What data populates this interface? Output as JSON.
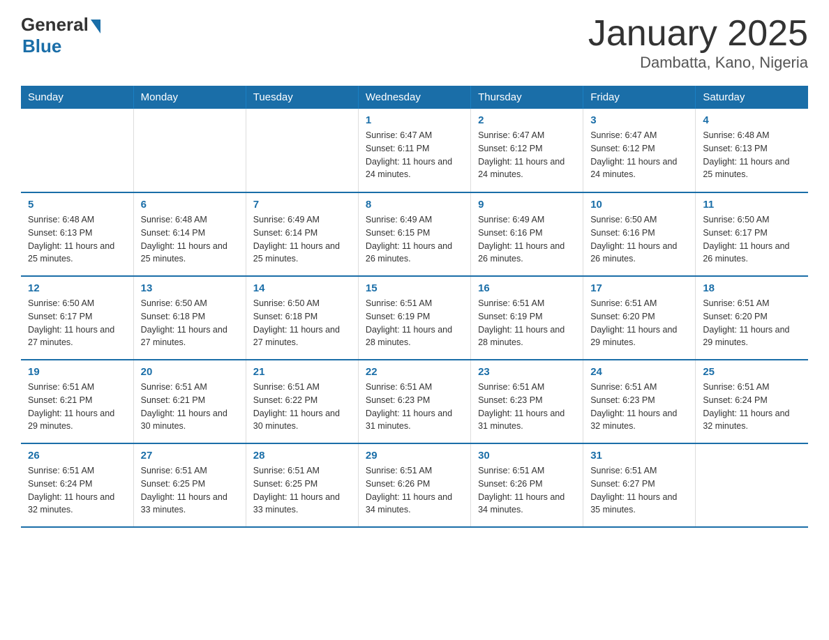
{
  "logo": {
    "general": "General",
    "blue": "Blue"
  },
  "title": "January 2025",
  "subtitle": "Dambatta, Kano, Nigeria",
  "days_of_week": [
    "Sunday",
    "Monday",
    "Tuesday",
    "Wednesday",
    "Thursday",
    "Friday",
    "Saturday"
  ],
  "weeks": [
    [
      {
        "day": "",
        "info": ""
      },
      {
        "day": "",
        "info": ""
      },
      {
        "day": "",
        "info": ""
      },
      {
        "day": "1",
        "info": "Sunrise: 6:47 AM\nSunset: 6:11 PM\nDaylight: 11 hours and 24 minutes."
      },
      {
        "day": "2",
        "info": "Sunrise: 6:47 AM\nSunset: 6:12 PM\nDaylight: 11 hours and 24 minutes."
      },
      {
        "day": "3",
        "info": "Sunrise: 6:47 AM\nSunset: 6:12 PM\nDaylight: 11 hours and 24 minutes."
      },
      {
        "day": "4",
        "info": "Sunrise: 6:48 AM\nSunset: 6:13 PM\nDaylight: 11 hours and 25 minutes."
      }
    ],
    [
      {
        "day": "5",
        "info": "Sunrise: 6:48 AM\nSunset: 6:13 PM\nDaylight: 11 hours and 25 minutes."
      },
      {
        "day": "6",
        "info": "Sunrise: 6:48 AM\nSunset: 6:14 PM\nDaylight: 11 hours and 25 minutes."
      },
      {
        "day": "7",
        "info": "Sunrise: 6:49 AM\nSunset: 6:14 PM\nDaylight: 11 hours and 25 minutes."
      },
      {
        "day": "8",
        "info": "Sunrise: 6:49 AM\nSunset: 6:15 PM\nDaylight: 11 hours and 26 minutes."
      },
      {
        "day": "9",
        "info": "Sunrise: 6:49 AM\nSunset: 6:16 PM\nDaylight: 11 hours and 26 minutes."
      },
      {
        "day": "10",
        "info": "Sunrise: 6:50 AM\nSunset: 6:16 PM\nDaylight: 11 hours and 26 minutes."
      },
      {
        "day": "11",
        "info": "Sunrise: 6:50 AM\nSunset: 6:17 PM\nDaylight: 11 hours and 26 minutes."
      }
    ],
    [
      {
        "day": "12",
        "info": "Sunrise: 6:50 AM\nSunset: 6:17 PM\nDaylight: 11 hours and 27 minutes."
      },
      {
        "day": "13",
        "info": "Sunrise: 6:50 AM\nSunset: 6:18 PM\nDaylight: 11 hours and 27 minutes."
      },
      {
        "day": "14",
        "info": "Sunrise: 6:50 AM\nSunset: 6:18 PM\nDaylight: 11 hours and 27 minutes."
      },
      {
        "day": "15",
        "info": "Sunrise: 6:51 AM\nSunset: 6:19 PM\nDaylight: 11 hours and 28 minutes."
      },
      {
        "day": "16",
        "info": "Sunrise: 6:51 AM\nSunset: 6:19 PM\nDaylight: 11 hours and 28 minutes."
      },
      {
        "day": "17",
        "info": "Sunrise: 6:51 AM\nSunset: 6:20 PM\nDaylight: 11 hours and 29 minutes."
      },
      {
        "day": "18",
        "info": "Sunrise: 6:51 AM\nSunset: 6:20 PM\nDaylight: 11 hours and 29 minutes."
      }
    ],
    [
      {
        "day": "19",
        "info": "Sunrise: 6:51 AM\nSunset: 6:21 PM\nDaylight: 11 hours and 29 minutes."
      },
      {
        "day": "20",
        "info": "Sunrise: 6:51 AM\nSunset: 6:21 PM\nDaylight: 11 hours and 30 minutes."
      },
      {
        "day": "21",
        "info": "Sunrise: 6:51 AM\nSunset: 6:22 PM\nDaylight: 11 hours and 30 minutes."
      },
      {
        "day": "22",
        "info": "Sunrise: 6:51 AM\nSunset: 6:23 PM\nDaylight: 11 hours and 31 minutes."
      },
      {
        "day": "23",
        "info": "Sunrise: 6:51 AM\nSunset: 6:23 PM\nDaylight: 11 hours and 31 minutes."
      },
      {
        "day": "24",
        "info": "Sunrise: 6:51 AM\nSunset: 6:23 PM\nDaylight: 11 hours and 32 minutes."
      },
      {
        "day": "25",
        "info": "Sunrise: 6:51 AM\nSunset: 6:24 PM\nDaylight: 11 hours and 32 minutes."
      }
    ],
    [
      {
        "day": "26",
        "info": "Sunrise: 6:51 AM\nSunset: 6:24 PM\nDaylight: 11 hours and 32 minutes."
      },
      {
        "day": "27",
        "info": "Sunrise: 6:51 AM\nSunset: 6:25 PM\nDaylight: 11 hours and 33 minutes."
      },
      {
        "day": "28",
        "info": "Sunrise: 6:51 AM\nSunset: 6:25 PM\nDaylight: 11 hours and 33 minutes."
      },
      {
        "day": "29",
        "info": "Sunrise: 6:51 AM\nSunset: 6:26 PM\nDaylight: 11 hours and 34 minutes."
      },
      {
        "day": "30",
        "info": "Sunrise: 6:51 AM\nSunset: 6:26 PM\nDaylight: 11 hours and 34 minutes."
      },
      {
        "day": "31",
        "info": "Sunrise: 6:51 AM\nSunset: 6:27 PM\nDaylight: 11 hours and 35 minutes."
      },
      {
        "day": "",
        "info": ""
      }
    ]
  ]
}
